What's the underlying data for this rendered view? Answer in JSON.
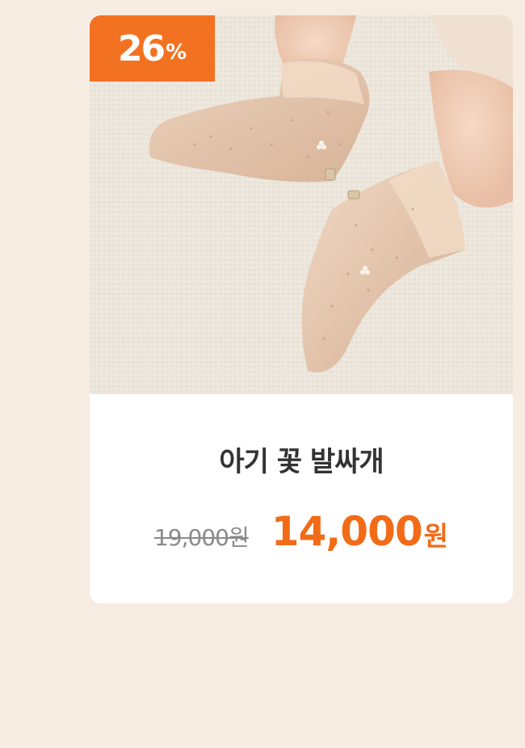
{
  "product": {
    "discount_value": "26",
    "discount_unit": "%",
    "name": "아기 꽃 발싸개",
    "original_price": "19,000원",
    "sale_price_number": "14,000",
    "sale_price_unit": "원"
  },
  "colors": {
    "page_background": "#f6ece2",
    "badge_background": "#f37221",
    "sale_price": "#f26b17",
    "original_price": "#8a8a8a",
    "title": "#333333"
  }
}
